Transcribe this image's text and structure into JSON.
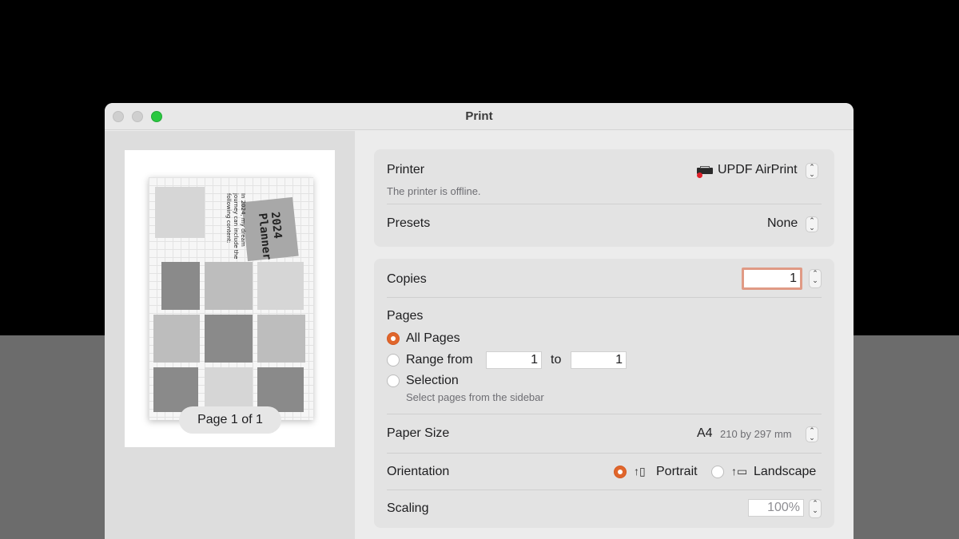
{
  "window": {
    "title": "Print"
  },
  "preview": {
    "page_indicator": "Page 1 of 1",
    "thumb_title": "2024 Planner",
    "thumb_text": "In 2024, my dream journey can include the following content:"
  },
  "printer": {
    "label": "Printer",
    "value": "UPDF AirPrint",
    "status": "The printer is offline."
  },
  "presets": {
    "label": "Presets",
    "value": "None"
  },
  "copies": {
    "label": "Copies",
    "value": "1"
  },
  "pages": {
    "label": "Pages",
    "all_label": "All Pages",
    "range_label": "Range from",
    "range_from": "1",
    "to_label": "to",
    "range_to": "1",
    "selection_label": "Selection",
    "selection_hint": "Select pages from the sidebar",
    "selected": "all"
  },
  "paper_size": {
    "label": "Paper Size",
    "value": "A4",
    "detail": "210 by 297 mm"
  },
  "orientation": {
    "label": "Orientation",
    "portrait_label": "Portrait",
    "landscape_label": "Landscape",
    "selected": "portrait"
  },
  "scaling": {
    "label": "Scaling",
    "value": "100%"
  },
  "colors": {
    "accent": "#e0662c",
    "window_bg": "#ececec",
    "panel_bg": "#e3e3e3",
    "zoom_light": "#2ac840"
  },
  "icons": {
    "printer": "printer-icon",
    "portrait": "portrait-orientation-icon",
    "landscape": "landscape-orientation-icon"
  }
}
